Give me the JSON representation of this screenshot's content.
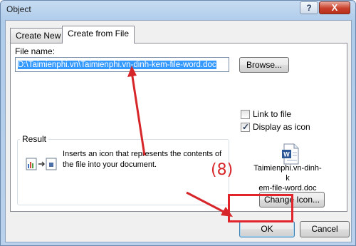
{
  "window": {
    "title": "Object",
    "help_label": "?",
    "close_label": "X"
  },
  "tabs": [
    {
      "label": "Create New",
      "active": false
    },
    {
      "label": "Create from File",
      "active": true
    }
  ],
  "file_name": {
    "label": "File name:",
    "value": "D:\\Taimienphi.vn\\Taimienphi.vn-dinh-kem-file-word.doc"
  },
  "browse_label": "Browse...",
  "link_to_file": {
    "label": "Link to file",
    "checked": false
  },
  "display_as_icon": {
    "label": "Display as icon",
    "checked": true
  },
  "result": {
    "title": "Result",
    "text": "Inserts an icon that represents the contents of the file into your document."
  },
  "icon_caption_line1": "Taimienphi.vn-dinh-k",
  "icon_caption_line2": "em-file-word.doc",
  "change_icon_label": "Change Icon...",
  "ok_label": "OK",
  "cancel_label": "Cancel",
  "annotation": {
    "step_label": "(8)",
    "color": "#d7262a"
  }
}
